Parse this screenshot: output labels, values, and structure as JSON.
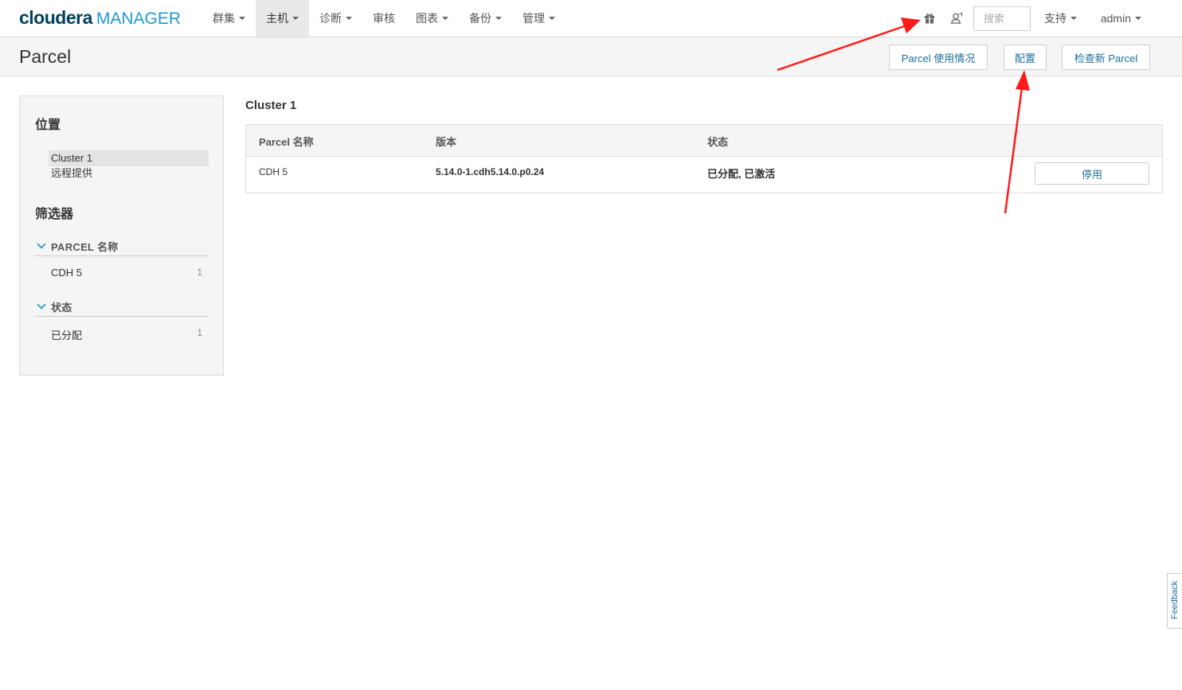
{
  "brand": {
    "name": "cloudera",
    "product": "MANAGER"
  },
  "nav": {
    "items": [
      {
        "label": "群集",
        "active": false
      },
      {
        "label": "主机",
        "active": true
      },
      {
        "label": "诊断",
        "active": false
      },
      {
        "label": "审核",
        "active": false
      },
      {
        "label": "图表",
        "active": false
      },
      {
        "label": "备份",
        "active": false
      },
      {
        "label": "管理",
        "active": false
      }
    ],
    "search_placeholder": "搜索",
    "support_label": "支持",
    "user_label": "admin",
    "icons": [
      "gift-icon",
      "user-location-icon"
    ]
  },
  "page": {
    "title": "Parcel",
    "buttons": {
      "usage": "Parcel 使用情况",
      "config": "配置",
      "check": "检查新 Parcel"
    }
  },
  "sidebar": {
    "location_heading": "位置",
    "locations": [
      {
        "label": "Cluster 1",
        "selected": true
      },
      {
        "label": "远程提供",
        "selected": false
      }
    ],
    "filter_heading": "筛选器",
    "facets": [
      {
        "title": "PARCEL 名称",
        "items": [
          {
            "label": "CDH 5",
            "count": "1"
          }
        ]
      },
      {
        "title": "状态",
        "items": [
          {
            "label": "已分配",
            "count": "1"
          }
        ]
      }
    ]
  },
  "main": {
    "cluster_title": "Cluster 1",
    "table": {
      "headers": [
        "Parcel 名称",
        "版本",
        "状态"
      ],
      "rows": [
        {
          "name": "CDH 5",
          "version": "5.14.0-1.cdh5.14.0.p0.24",
          "status": "已分配, 已激活",
          "action": "停用"
        }
      ]
    }
  },
  "feedback_label": "Feedback",
  "colors": {
    "brand_dark": "#00405e",
    "brand_accent": "#1d9ad6",
    "link": "#1f6f9f",
    "annotation_arrow": "#ff1a1a"
  }
}
